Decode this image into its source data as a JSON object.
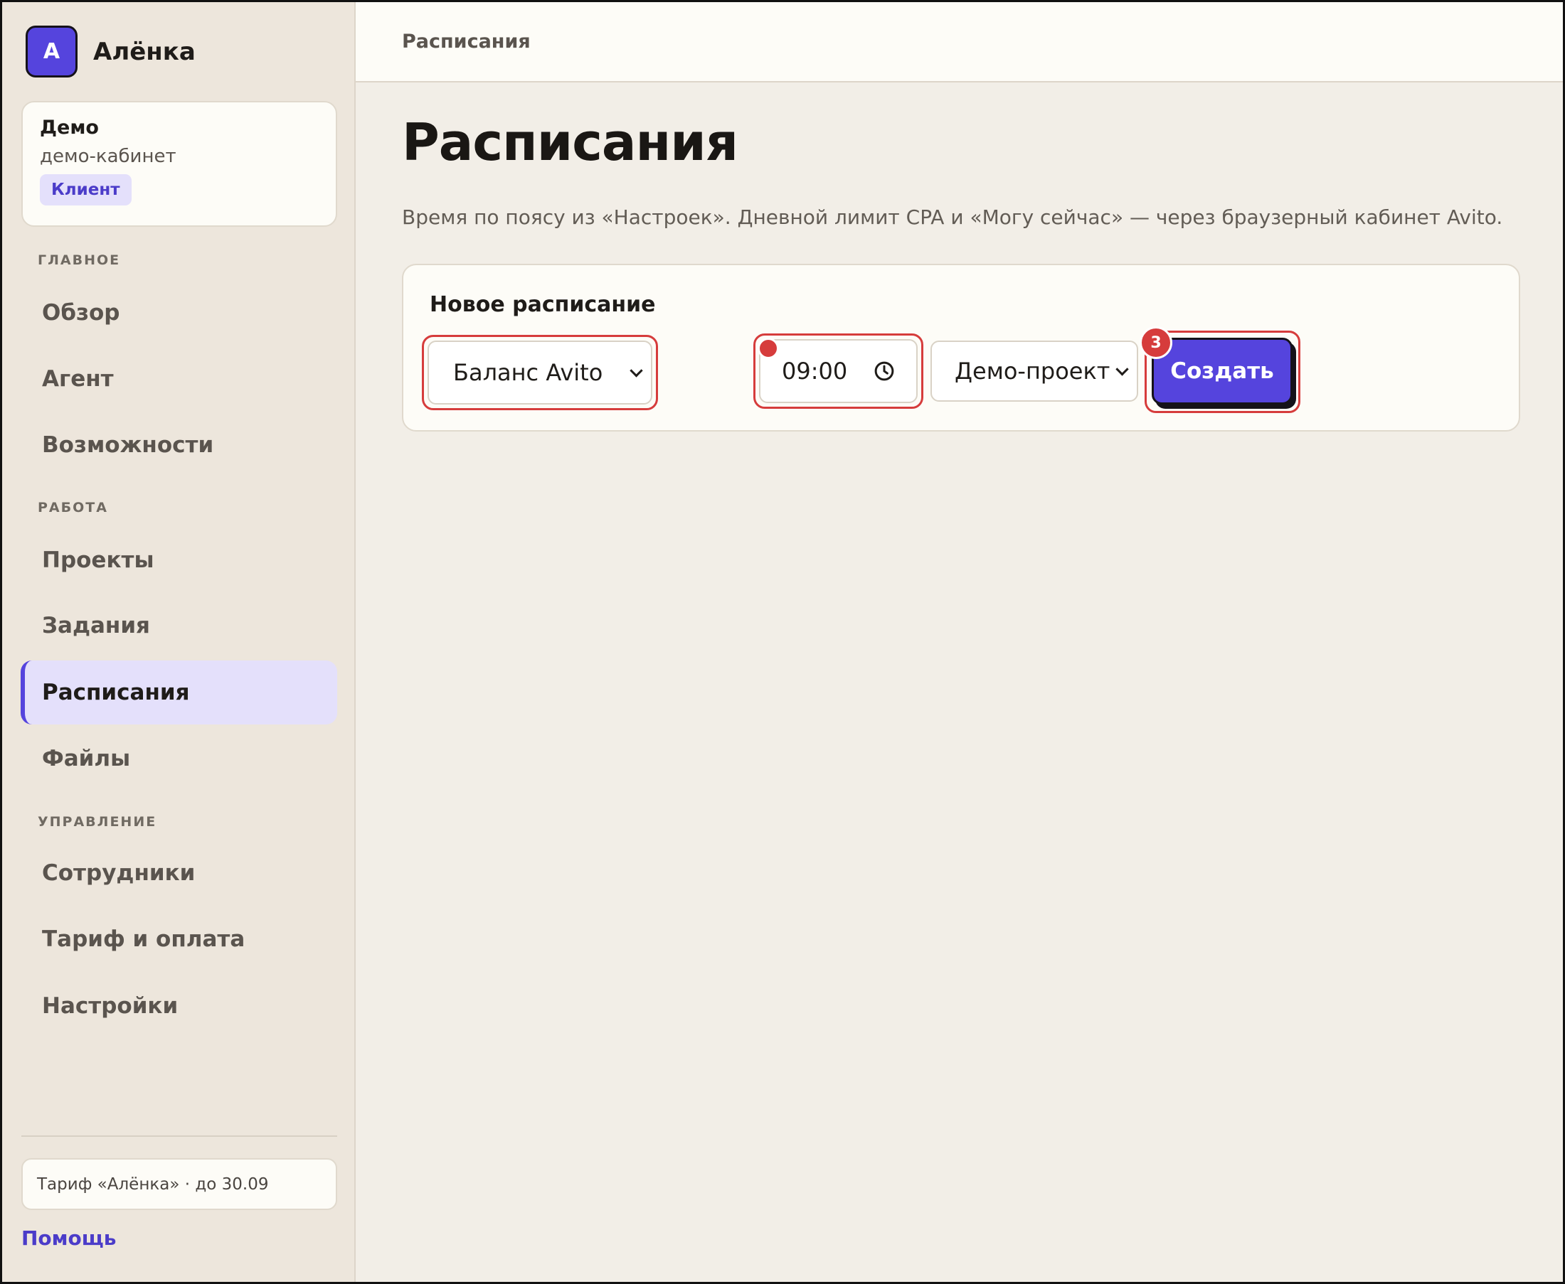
{
  "sidebar": {
    "brand": {
      "initial": "А",
      "name": "Алёнка"
    },
    "account": {
      "name": "Демо",
      "subtitle": "демо-кабинет",
      "role": "Клиент"
    },
    "sections": {
      "main": "ГЛАВНОЕ",
      "work": "РАБОТА",
      "manage": "УПРАВЛЕНИЕ"
    },
    "items": {
      "overview": "Обзор",
      "agent": "Агент",
      "features": "Возможности",
      "projects": "Проекты",
      "tasks": "Задания",
      "schedules": "Расписания",
      "files": "Файлы",
      "staff": "Сотрудники",
      "billing": "Тариф и оплата",
      "settings": "Настройки"
    },
    "active_item": "schedules",
    "plan": "Тариф «Алёнка» · до 30.09",
    "help": "Помощь"
  },
  "topbar": {
    "breadcrumb": "Расписания"
  },
  "main": {
    "title": "Расписания",
    "description": "Время по поясу из «Настроек». Дневной лимит CPA и «Могу сейчас» — через браузерный кабинет Avito.",
    "card": {
      "title": "Новое расписание",
      "task_select": "Баланс Avito",
      "time_value": "09:00",
      "project_select": "Демо-проект",
      "create_label": "Создать",
      "marker_number": "3"
    }
  },
  "colors": {
    "accent": "#5544dd",
    "accent_soft": "#e4e0fb",
    "highlight": "#d63c3c",
    "sidebar_bg": "#ede6dc",
    "main_bg": "#f2eee7"
  },
  "icons": {
    "time": "clock-icon",
    "select": "chevron-down-icon"
  }
}
